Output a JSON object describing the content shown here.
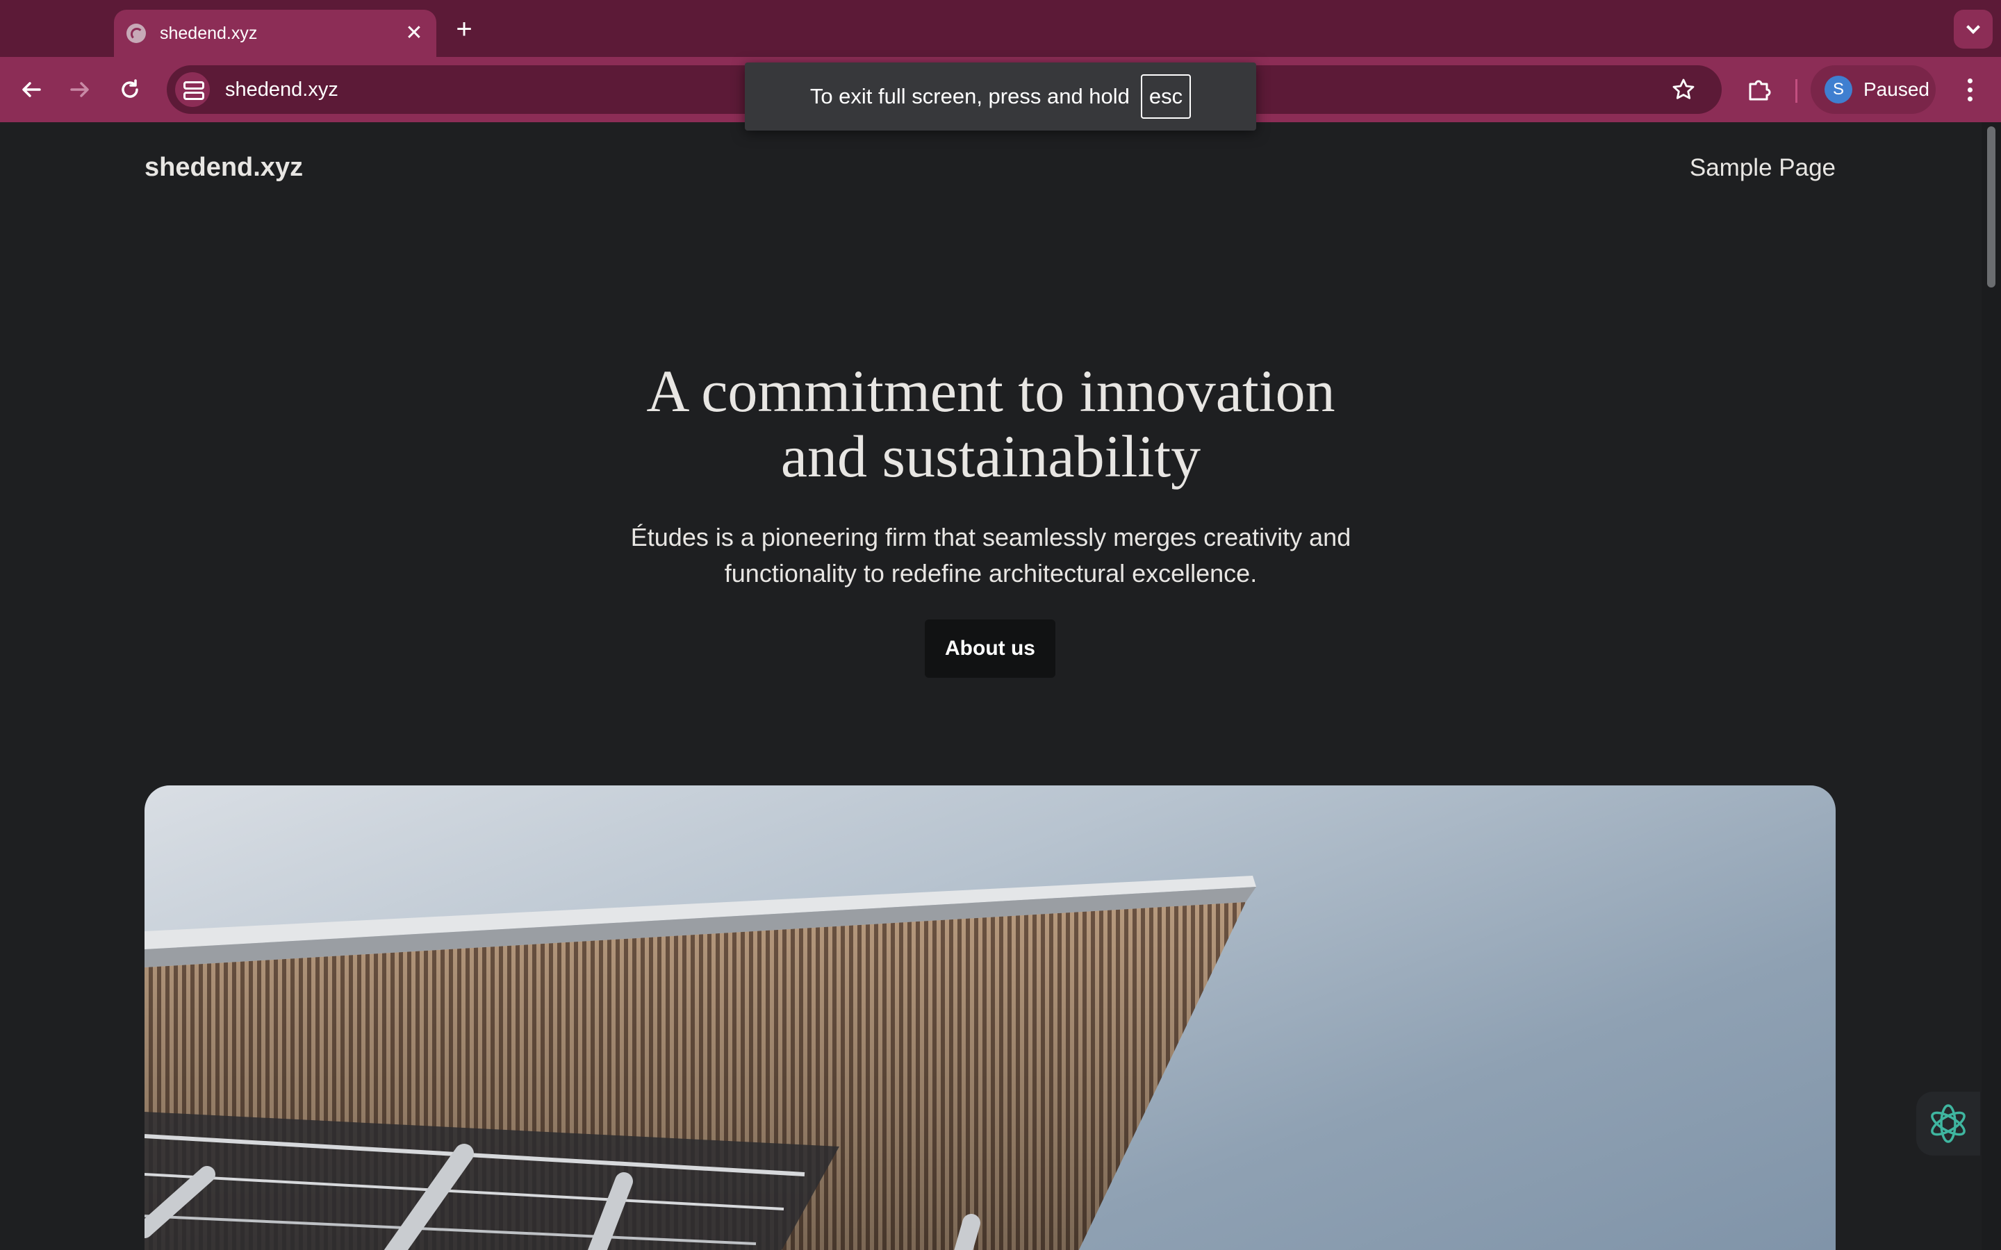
{
  "browser": {
    "tab": {
      "title": "shedend.xyz",
      "close_glyph": "✕",
      "favicon": "globe-icon"
    },
    "new_tab_glyph": "+",
    "address_bar": {
      "url": "shedend.xyz"
    },
    "profile": {
      "initial": "S",
      "status": "Paused"
    },
    "fullscreen_toast": {
      "message": "To exit full screen, press and hold",
      "key": "esc"
    },
    "colors": {
      "frame": "#5c1a37",
      "toolbar": "#8c2d56"
    }
  },
  "site": {
    "title": "shedend.xyz",
    "nav": {
      "sample_page": "Sample Page"
    },
    "hero": {
      "heading_line1": "A commitment to innovation",
      "heading_line2": "and sustainability",
      "subtitle": "Études is a pioneering firm that seamlessly merges creativity and functionality to redefine architectural excellence.",
      "cta_label": "About us"
    }
  }
}
